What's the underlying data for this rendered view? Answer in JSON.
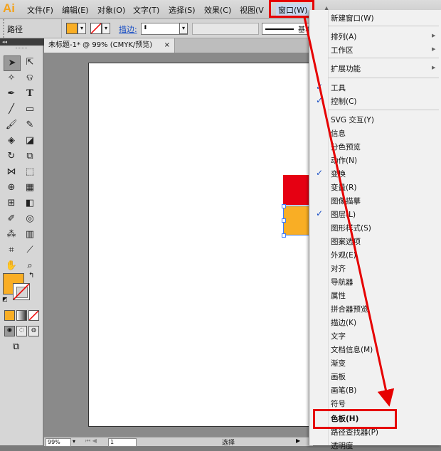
{
  "menubar": {
    "logo": "Ai",
    "items": [
      "文件(F)",
      "编辑(E)",
      "对象(O)",
      "文字(T)",
      "选择(S)",
      "效果(C)",
      "视图(V",
      "窗口(W)"
    ]
  },
  "control": {
    "label": "路径",
    "stroke_label": "描边:",
    "basic_label": "基本"
  },
  "document": {
    "tab_title": "未标题-1* @ 99% (CMYK/预览)",
    "tab_close": "×",
    "panel_collapse": "◂◂"
  },
  "status": {
    "zoom": "99%",
    "page": "1",
    "mode": "选择"
  },
  "window_menu": {
    "items": [
      {
        "label": "新建窗口(W)",
        "checked": false
      },
      {
        "label": "排列(A)",
        "checked": false
      },
      {
        "label": "工作区",
        "checked": false
      },
      {
        "label": "扩展功能",
        "checked": false
      },
      {
        "label": "工具",
        "checked": true
      },
      {
        "label": "控制(C)",
        "checked": true
      },
      {
        "label": "SVG 交互(Y)",
        "checked": false
      },
      {
        "label": "信息",
        "checked": false
      },
      {
        "label": "分色预览",
        "checked": false
      },
      {
        "label": "动作(N)",
        "checked": false
      },
      {
        "label": "变换",
        "checked": true
      },
      {
        "label": "变量(R)",
        "checked": false
      },
      {
        "label": "图像描摹",
        "checked": false
      },
      {
        "label": "图层(L)",
        "checked": true
      },
      {
        "label": "图形样式(S)",
        "checked": false
      },
      {
        "label": "图案选项",
        "checked": false
      },
      {
        "label": "外观(E)",
        "checked": false
      },
      {
        "label": "对齐",
        "checked": false
      },
      {
        "label": "导航器",
        "checked": false
      },
      {
        "label": "属性",
        "checked": false
      },
      {
        "label": "拼合器预览",
        "checked": false
      },
      {
        "label": "描边(K)",
        "checked": false
      },
      {
        "label": "文字",
        "checked": false
      },
      {
        "label": "文档信息(M)",
        "checked": false
      },
      {
        "label": "渐变",
        "checked": false
      },
      {
        "label": "画板",
        "checked": false
      },
      {
        "label": "画笔(B)",
        "checked": false
      },
      {
        "label": "符号",
        "checked": false
      },
      {
        "label": "色板(H)",
        "checked": false
      },
      {
        "label": "路径查找器(P)",
        "checked": false
      },
      {
        "label": "透明度",
        "checked": false
      }
    ]
  },
  "colors": {
    "fill": "#f9ae25",
    "red_shape": "#e60012",
    "highlight": "#e60000"
  }
}
